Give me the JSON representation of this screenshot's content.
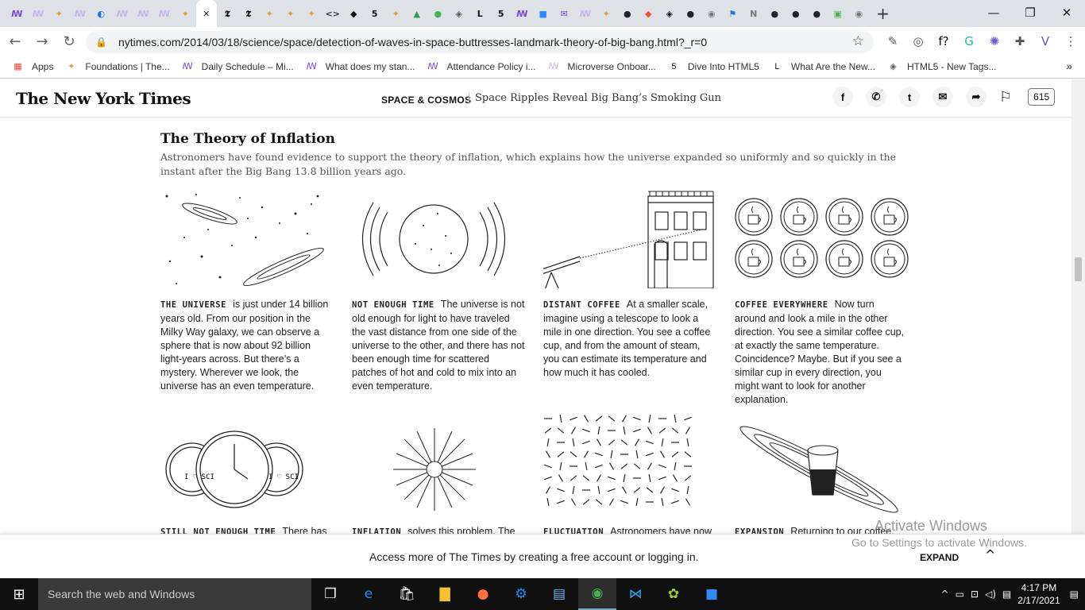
{
  "browser": {
    "tabs": [
      {
        "icon": "ꟿ",
        "color": "#7b3fe4"
      },
      {
        "icon": "ꟿ",
        "color": "#c9b3ee"
      },
      {
        "icon": "✦",
        "color": "#e0a030"
      },
      {
        "icon": "ꟿ",
        "color": "#c9b3ee"
      },
      {
        "icon": "◐",
        "color": "#1a73e8"
      },
      {
        "icon": "ꟿ",
        "color": "#c9b3ee"
      },
      {
        "icon": "ꟿ",
        "color": "#c9b3ee"
      },
      {
        "icon": "ꟿ",
        "color": "#c9b3ee"
      },
      {
        "icon": "✦",
        "color": "#e0a030"
      },
      {
        "icon": "✕",
        "color": "#222",
        "active": true
      },
      {
        "icon": "𝕿",
        "color": "#111"
      },
      {
        "icon": "𝕿",
        "color": "#111"
      },
      {
        "icon": "✦",
        "color": "#e0a030"
      },
      {
        "icon": "✦",
        "color": "#e0a030"
      },
      {
        "icon": "✦",
        "color": "#e0a030"
      },
      {
        "icon": "<>",
        "color": "#333"
      },
      {
        "icon": "◆",
        "color": "#111"
      },
      {
        "icon": "5",
        "color": "#111"
      },
      {
        "icon": "✦",
        "color": "#e0a030"
      },
      {
        "icon": "▲",
        "color": "#2e9e4f"
      },
      {
        "icon": "●",
        "color": "#4caf50"
      },
      {
        "icon": "◈",
        "color": "#555"
      },
      {
        "icon": "L",
        "color": "#111"
      },
      {
        "icon": "5",
        "color": "#111"
      },
      {
        "icon": "ꟿ",
        "color": "#7b3fe4"
      },
      {
        "icon": "■",
        "color": "#2d8cff"
      },
      {
        "icon": "✉",
        "color": "#7b3fe4"
      },
      {
        "icon": "ꟿ",
        "color": "#c9b3ee"
      },
      {
        "icon": "✦",
        "color": "#e0a030"
      },
      {
        "icon": "●",
        "color": "#222"
      },
      {
        "icon": "◆",
        "color": "#f05033"
      },
      {
        "icon": "◈",
        "color": "#111"
      },
      {
        "icon": "●",
        "color": "#222"
      },
      {
        "icon": "◉",
        "color": "#777"
      },
      {
        "icon": "⚑",
        "color": "#1a73e8"
      },
      {
        "icon": "N",
        "color": "#777"
      },
      {
        "icon": "●",
        "color": "#222"
      },
      {
        "icon": "●",
        "color": "#222"
      },
      {
        "icon": "●",
        "color": "#222"
      },
      {
        "icon": "▣",
        "color": "#4caf50"
      },
      {
        "icon": "◉",
        "color": "#777"
      }
    ],
    "new_tab": "+",
    "window_controls": [
      "—",
      "❐",
      "✕"
    ],
    "url": "nytimes.com/2014/03/18/science/space/detection-of-waves-in-space-buttresses-landmark-theory-of-big-bang.html?_r=0",
    "extensions": [
      {
        "icon": "✎",
        "color": "#555"
      },
      {
        "icon": "◎",
        "color": "#555"
      },
      {
        "icon": "f?",
        "color": "#111"
      },
      {
        "icon": "G",
        "color": "#15c39a"
      },
      {
        "icon": "✺",
        "color": "#6a5acd"
      },
      {
        "icon": "✚",
        "color": "#555"
      },
      {
        "icon": "V",
        "color": "#6b4fbb"
      },
      {
        "icon": "⋮",
        "color": "#555"
      }
    ],
    "bookmarks": [
      {
        "icon": "▦",
        "color": "#ea4335",
        "label": "Apps"
      },
      {
        "icon": "✦",
        "color": "#e0a030",
        "label": "Foundations | The..."
      },
      {
        "icon": "ꟿ",
        "color": "#7b3fe4",
        "label": "Daily Schedule – Mi..."
      },
      {
        "icon": "ꟿ",
        "color": "#7b3fe4",
        "label": "What does my stan..."
      },
      {
        "icon": "ꟿ",
        "color": "#7b3fe4",
        "label": "Attendance Policy i..."
      },
      {
        "icon": "ꟿ",
        "color": "#c9b3ee",
        "label": "Microverse Onboar..."
      },
      {
        "icon": "5",
        "color": "#111",
        "label": "Dive Into HTML5"
      },
      {
        "icon": "L",
        "color": "#111",
        "label": "What Are the New..."
      },
      {
        "icon": "◈",
        "color": "#555",
        "label": "HTML5 - New Tags..."
      }
    ],
    "bookmarks_more": "»"
  },
  "nyt": {
    "logo": "The New York Times",
    "section": "SPACE & COSMOS",
    "headline": "Space Ripples Reveal Big Bang’s Smoking Gun",
    "share_icons": [
      "f",
      "✆",
      "t",
      "✉",
      "➦"
    ],
    "comment_count": "615"
  },
  "graphic": {
    "title": "The Theory of Inflation",
    "deck": "Astronomers have found evidence to support the theory of inflation, which explains how the universe expanded so uniformly and so quickly in the instant after the Big Bang 13.8 billion years ago.",
    "panels": [
      {
        "label": "THE UNIVERSE",
        "text": "is just under 14 billion years old. From our position in the Milky Way galaxy, we can observe a sphere that is now about 92 billion light-years across. But there’s a mystery. Wherever we look, the universe has an even temperature."
      },
      {
        "label": "NOT ENOUGH TIME",
        "text": "The universe is not old enough for light to have traveled the vast distance from one side of the universe to the other, and there has not been enough time for scattered patches of hot and cold to mix into an even temperature."
      },
      {
        "label": "DISTANT COFFEE",
        "text": "At a smaller scale, imagine using a telescope to look a mile in one direction. You see a coffee cup, and from the amount of steam, you can estimate its temperature and how much it has cooled."
      },
      {
        "label": "COFFEE EVERYWHERE",
        "text": "Now turn around and look a mile in the other direction. You see a similar coffee cup, at exactly the same temperature. Coincidence? Maybe. But if you see a similar cup in every direction, you might want to look for another explanation."
      },
      {
        "label": "STILL NOT ENOUGH TIME",
        "text": "There has"
      },
      {
        "label": "INFLATION",
        "text": "solves this problem. The"
      },
      {
        "label": "FLUCTUATION",
        "text": "Astronomers have now"
      },
      {
        "label": "EXPANSION",
        "text": "Returning to our coffee,"
      }
    ],
    "cup_text": "I ♡ SCI"
  },
  "gate": {
    "text": "Access more of The Times by creating a free account or logging in.",
    "expand": "EXPAND",
    "chevron": "^"
  },
  "watermark": {
    "line1": "Activate Windows",
    "line2": "Go to Settings to activate Windows."
  },
  "taskbar": {
    "start": "⊞",
    "search_placeholder": "Search the web and Windows",
    "apps": [
      {
        "name": "task-view",
        "icon": "❐",
        "color": "#fff"
      },
      {
        "name": "edge",
        "icon": "e",
        "color": "#1e90ff"
      },
      {
        "name": "store",
        "icon": "🛍",
        "color": "#fff"
      },
      {
        "name": "file-explorer",
        "icon": "▇",
        "color": "#f4c430"
      },
      {
        "name": "firefox",
        "icon": "●",
        "color": "#ff7139"
      },
      {
        "name": "settings",
        "icon": "⚙",
        "color": "#1e90ff"
      },
      {
        "name": "control-panel",
        "icon": "▤",
        "color": "#6cb4ee"
      },
      {
        "name": "chrome",
        "icon": "◉",
        "color": "#4caf50",
        "active": true
      },
      {
        "name": "vscode",
        "icon": "⋈",
        "color": "#22a7f0"
      },
      {
        "name": "paint",
        "icon": "✿",
        "color": "#a4c639"
      },
      {
        "name": "zoom",
        "icon": "■",
        "color": "#2d8cff"
      }
    ],
    "tray_icons": [
      "^",
      "▭",
      "⊡",
      "◁)",
      "▤"
    ],
    "time": "4:17 PM",
    "date": "2/17/2021",
    "notifications": "▤"
  }
}
